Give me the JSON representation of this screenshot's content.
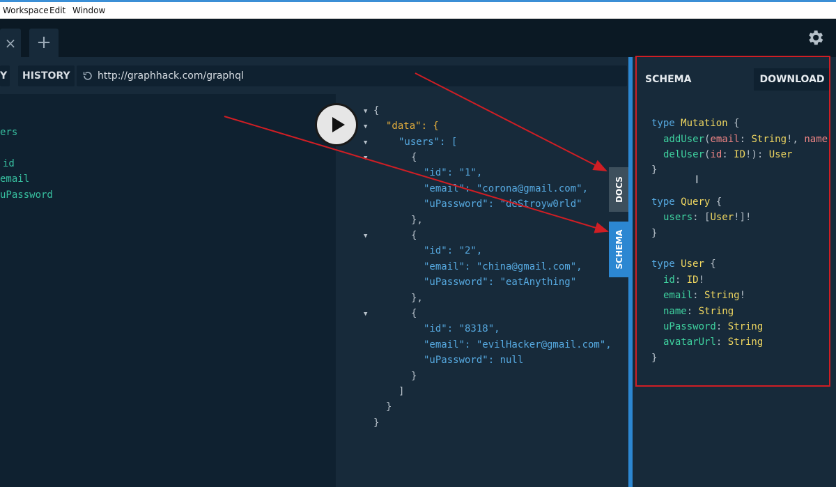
{
  "menu": [
    "Workspace",
    "Edit",
    "Window"
  ],
  "tabs": {
    "close_glyph": "×",
    "add_glyph": "+"
  },
  "toolbar": {
    "prettify_partial": "Y",
    "history": "HISTORY",
    "url": "http://graphhack.com/graphql"
  },
  "query_lines": [
    "ers",
    "id",
    "email",
    "uPassword"
  ],
  "side_tabs": {
    "docs": "DOCS",
    "schema": "SCHEMA"
  },
  "schema_panel": {
    "title": "SCHEMA",
    "download": "DOWNLOAD"
  },
  "colors": {
    "accent": "#2c87d2",
    "highlight": "#d01e24",
    "arrow": "#d01e24"
  },
  "icons": [
    "close-icon",
    "plus-icon",
    "gear-icon",
    "reload-icon",
    "play-icon",
    "text-cursor-icon"
  ],
  "result_json": [
    {
      "t": "{"
    },
    {
      "t": "\"data\": {"
    },
    {
      "t": "\"users\": ["
    },
    {
      "t": "{"
    },
    {
      "t": "\"id\": \"1\","
    },
    {
      "t": "\"email\": \"corona@gmail.com\","
    },
    {
      "t": "\"uPassword\": \"deStroyw0rld\""
    },
    {
      "t": "},"
    },
    {
      "t": "{"
    },
    {
      "t": "\"id\": \"2\","
    },
    {
      "t": "\"email\": \"china@gmail.com\","
    },
    {
      "t": "\"uPassword\": \"eatAnything\""
    },
    {
      "t": "},"
    },
    {
      "t": "{"
    },
    {
      "t": "\"id\": \"8318\","
    },
    {
      "t": "\"email\": \"evilHacker@gmail.com\","
    },
    {
      "t": "\"uPassword\": null"
    },
    {
      "t": "}"
    },
    {
      "t": "]"
    },
    {
      "t": "}"
    },
    {
      "t": "}"
    }
  ],
  "schema_lines": [
    "type Mutation {",
    "addUser(email: String!, name",
    "delUser(id: ID!): User",
    "}",
    "type Query {",
    "users: [User!]!",
    "}",
    "type User {",
    "id: ID!",
    "email: String!",
    "name: String",
    "uPassword: String",
    "avatarUrl: String",
    "}"
  ]
}
